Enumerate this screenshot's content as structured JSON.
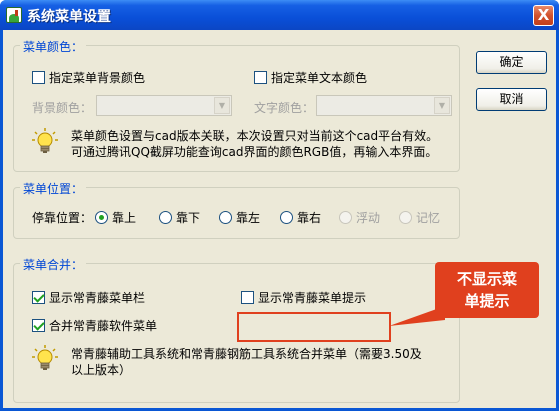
{
  "window": {
    "title": "系统菜单设置",
    "close_glyph": "X"
  },
  "buttons": {
    "ok": "确定",
    "cancel": "取消"
  },
  "menu_color": {
    "title": "菜单颜色：",
    "bg_checkbox": {
      "label": "指定菜单背景颜色",
      "checked": false
    },
    "text_checkbox": {
      "label": "指定菜单文本颜色",
      "checked": false
    },
    "bg_color_label": "背景颜色：",
    "text_color_label": "文字颜色：",
    "bg_color_value": "",
    "text_color_value": "",
    "tip_line1": "菜单颜色设置与cad版本关联，本次设置只对当前这个cad平台有效。",
    "tip_line2": "可通过腾讯QQ截屏功能查询cad界面的颜色RGB值，再输入本界面。"
  },
  "menu_position": {
    "title": "菜单位置：",
    "dock_label": "停靠位置：",
    "options": [
      {
        "label": "靠上",
        "selected": true,
        "enabled": true
      },
      {
        "label": "靠下",
        "selected": false,
        "enabled": true
      },
      {
        "label": "靠左",
        "selected": false,
        "enabled": true
      },
      {
        "label": "靠右",
        "selected": false,
        "enabled": true
      },
      {
        "label": "浮动",
        "selected": false,
        "enabled": false
      },
      {
        "label": "记忆",
        "selected": false,
        "enabled": false
      }
    ]
  },
  "menu_merge": {
    "title": "菜单合并：",
    "show_menubar": {
      "label": "显示常青藤菜单栏",
      "checked": true
    },
    "show_tips": {
      "label": "显示常青藤菜单提示",
      "checked": false
    },
    "merge_software": {
      "label": "合并常青藤软件菜单",
      "checked": true
    },
    "tip_line1": "常青藤辅助工具系统和常青藤钢筋工具系统合并菜单（需要3.50及",
    "tip_line2": "以上版本）"
  },
  "annotation": {
    "line1": "不显示菜",
    "line2": "单提示",
    "color": "#e0401e"
  },
  "icons": {
    "app": "app-icon",
    "tip": "lightbulb-icon",
    "close": "close-icon"
  }
}
